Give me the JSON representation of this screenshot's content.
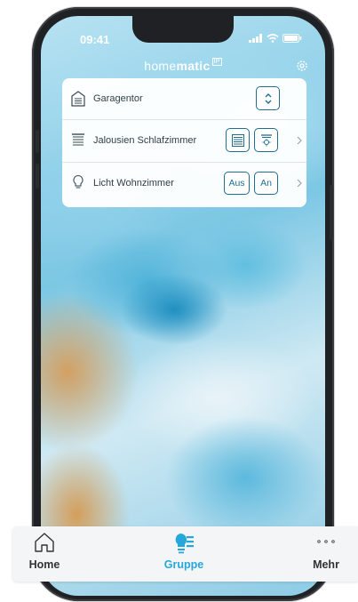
{
  "status_bar": {
    "time": "09:41"
  },
  "app": {
    "brand_light": "home",
    "brand_bold": "matic",
    "brand_badge": "IP"
  },
  "devices": [
    {
      "label": "Garagentor",
      "icon": "garage-door-icon",
      "controls": [
        "stepper-up-down"
      ]
    },
    {
      "label": "Jalousien Schlafzimmer",
      "icon": "blinds-icon",
      "controls": [
        "blinds-closed",
        "blinds-open-sun"
      ],
      "has_chevron": true
    },
    {
      "label": "Licht Wohnzimmer",
      "icon": "lightbulb-icon",
      "controls": [
        "Aus",
        "An"
      ],
      "has_chevron": true
    }
  ],
  "tabbar": {
    "items": [
      {
        "label": "Home",
        "icon": "house-icon",
        "active": false
      },
      {
        "label": "Gruppe",
        "icon": "group-lightbulb-icon",
        "active": true
      },
      {
        "label": "Mehr",
        "icon": "more-dots-icon",
        "active": false
      }
    ],
    "active_color": "#25a7dc",
    "inactive_color": "#333333"
  },
  "colors": {
    "accent": "#1d6e8f",
    "tab_active": "#25a7dc"
  }
}
